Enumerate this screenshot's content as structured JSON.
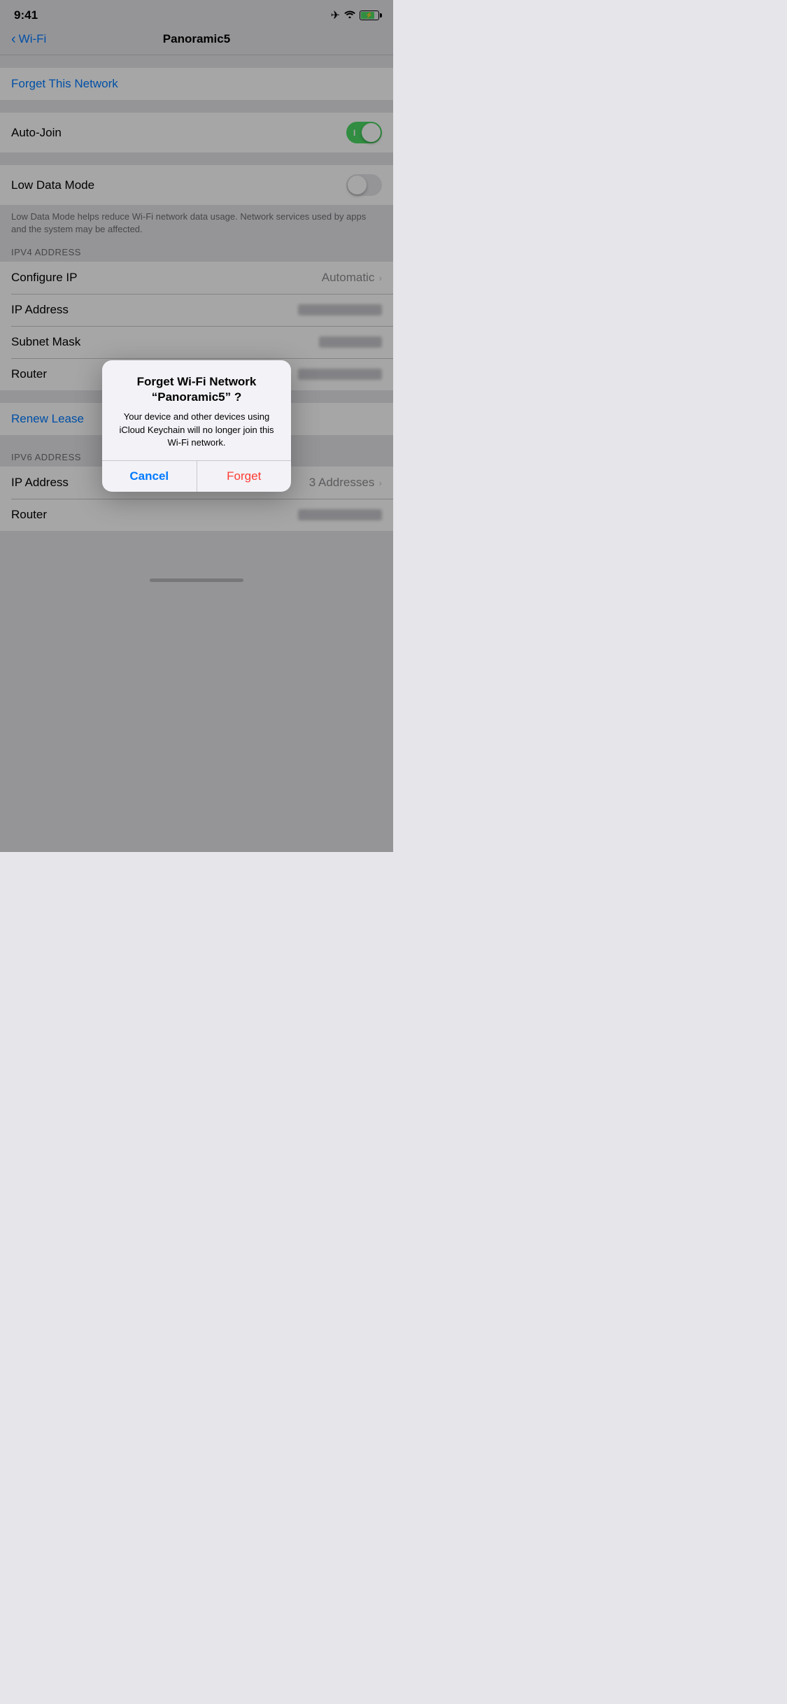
{
  "statusBar": {
    "time": "9:41"
  },
  "navBar": {
    "backLabel": "Wi-Fi",
    "title": "Panoramic5"
  },
  "sections": {
    "forgetNetwork": "Forget This Network",
    "autoJoin": "Auto-Join",
    "lowDataMode": "Low Data Mode",
    "lowDataDesc": "Low Data Mode helps reduce Wi-Fi network data usage. Network services used by apps and the system may be affected.",
    "ipv4Header": "IPV4 ADDRESS",
    "configurIP": "Configure IP",
    "configureValue": "Automatic",
    "ipAddress": "IP Address",
    "subnetMask": "Subnet Mask",
    "router": "Router",
    "renewLease": "Renew Lease",
    "ipv6Header": "IPV6 ADDRESS",
    "ipv6IpAddress": "IP Address",
    "ipv6IpValue": "3 Addresses",
    "ipv6Router": "Router"
  },
  "alert": {
    "title": "Forget Wi-Fi Network “Panoramic5” ?",
    "message": "Your device and other devices using iCloud Keychain will no longer join this Wi-Fi network.",
    "cancelLabel": "Cancel",
    "forgetLabel": "Forget"
  },
  "icons": {
    "airplane": "✈",
    "wifi": "📶",
    "chevronLeft": "‹",
    "chevronRight": "›"
  }
}
